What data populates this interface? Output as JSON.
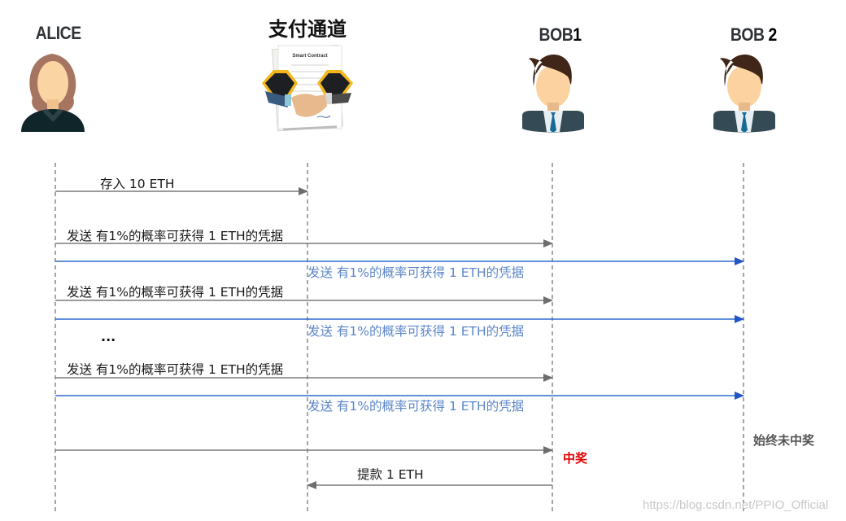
{
  "actors": {
    "alice": {
      "label": "ALICE"
    },
    "channel": {
      "label": "支付通道",
      "doc_title": "Smart Contract"
    },
    "bob1": {
      "label": "BOB",
      "num": "1"
    },
    "bob2": {
      "label": "BOB ",
      "num": "2"
    }
  },
  "colors": {
    "gray_arrow": "#7a7a7a",
    "blue_arrow": "#2f6bd0",
    "lifeline": "#6a6a6a",
    "win_note": "#e00000"
  },
  "messages": [
    {
      "id": "deposit",
      "from": "alice",
      "to": "channel",
      "text": "存入 10 ETH",
      "style": "gray"
    },
    {
      "id": "send1-bob1",
      "from": "alice",
      "to": "bob1",
      "text": "发送 有1%的概率可获得 1 ETH的凭据",
      "style": "gray"
    },
    {
      "id": "send1-bob2",
      "from": "alice",
      "to": "bob2",
      "text": "发送 有1%的概率可获得 1 ETH的凭据",
      "style": "blue"
    },
    {
      "id": "send2-bob1",
      "from": "alice",
      "to": "bob1",
      "text": "发送 有1%的概率可获得 1 ETH的凭据",
      "style": "gray"
    },
    {
      "id": "send2-bob2",
      "from": "alice",
      "to": "bob2",
      "text": "发送 有1%的概率可获得 1 ETH的凭据",
      "style": "blue"
    },
    {
      "id": "send3-bob1",
      "from": "alice",
      "to": "bob1",
      "text": "发送 有1%的概率可获得 1 ETH的凭据",
      "style": "gray"
    },
    {
      "id": "send3-bob2",
      "from": "alice",
      "to": "bob2",
      "text": "发送 有1%的概率可获得 1 ETH的凭据",
      "style": "blue"
    },
    {
      "id": "win",
      "from": "alice",
      "to": "bob1",
      "text": "",
      "style": "gray"
    },
    {
      "id": "withdraw",
      "from": "bob1",
      "to": "channel",
      "text": "提款  1 ETH",
      "style": "gray"
    }
  ],
  "ellipsis": "...",
  "notes": {
    "bob1_win": "中奖",
    "bob2_never": "始终未中奖"
  },
  "watermark": "https://blog.csdn.net/PPIO_Official"
}
